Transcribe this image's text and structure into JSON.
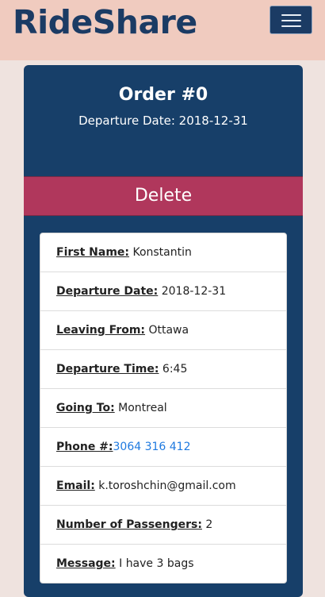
{
  "navbar": {
    "brand": "RideShare",
    "menu_icon": "hamburger-menu-icon"
  },
  "order": {
    "title": "Order #0",
    "departure_line": "Departure Date: 2018-12-31",
    "delete_label": "Delete"
  },
  "details": [
    {
      "label": "First Name:",
      "value": "Konstantin"
    },
    {
      "label": "Departure Date:",
      "value": "2018-12-31"
    },
    {
      "label": "Leaving From:",
      "value": "Ottawa"
    },
    {
      "label": "Departure Time:",
      "value": "6:45"
    },
    {
      "label": "Going To:",
      "value": "Montreal"
    },
    {
      "label": "Phone #:",
      "value": "3064 316 412"
    },
    {
      "label": "Email:",
      "value": "k.toroshchin@gmail.com"
    },
    {
      "label": "Number of Passengers:",
      "value": "2"
    },
    {
      "label": "Message:",
      "value": "I have 3 bags"
    }
  ],
  "colors": {
    "navbar_bg": "#f0cbbf",
    "brand": "#1b3b64",
    "card_bg": "#173f69",
    "delete_bg": "#b0375c",
    "link": "#1f7ae0"
  }
}
